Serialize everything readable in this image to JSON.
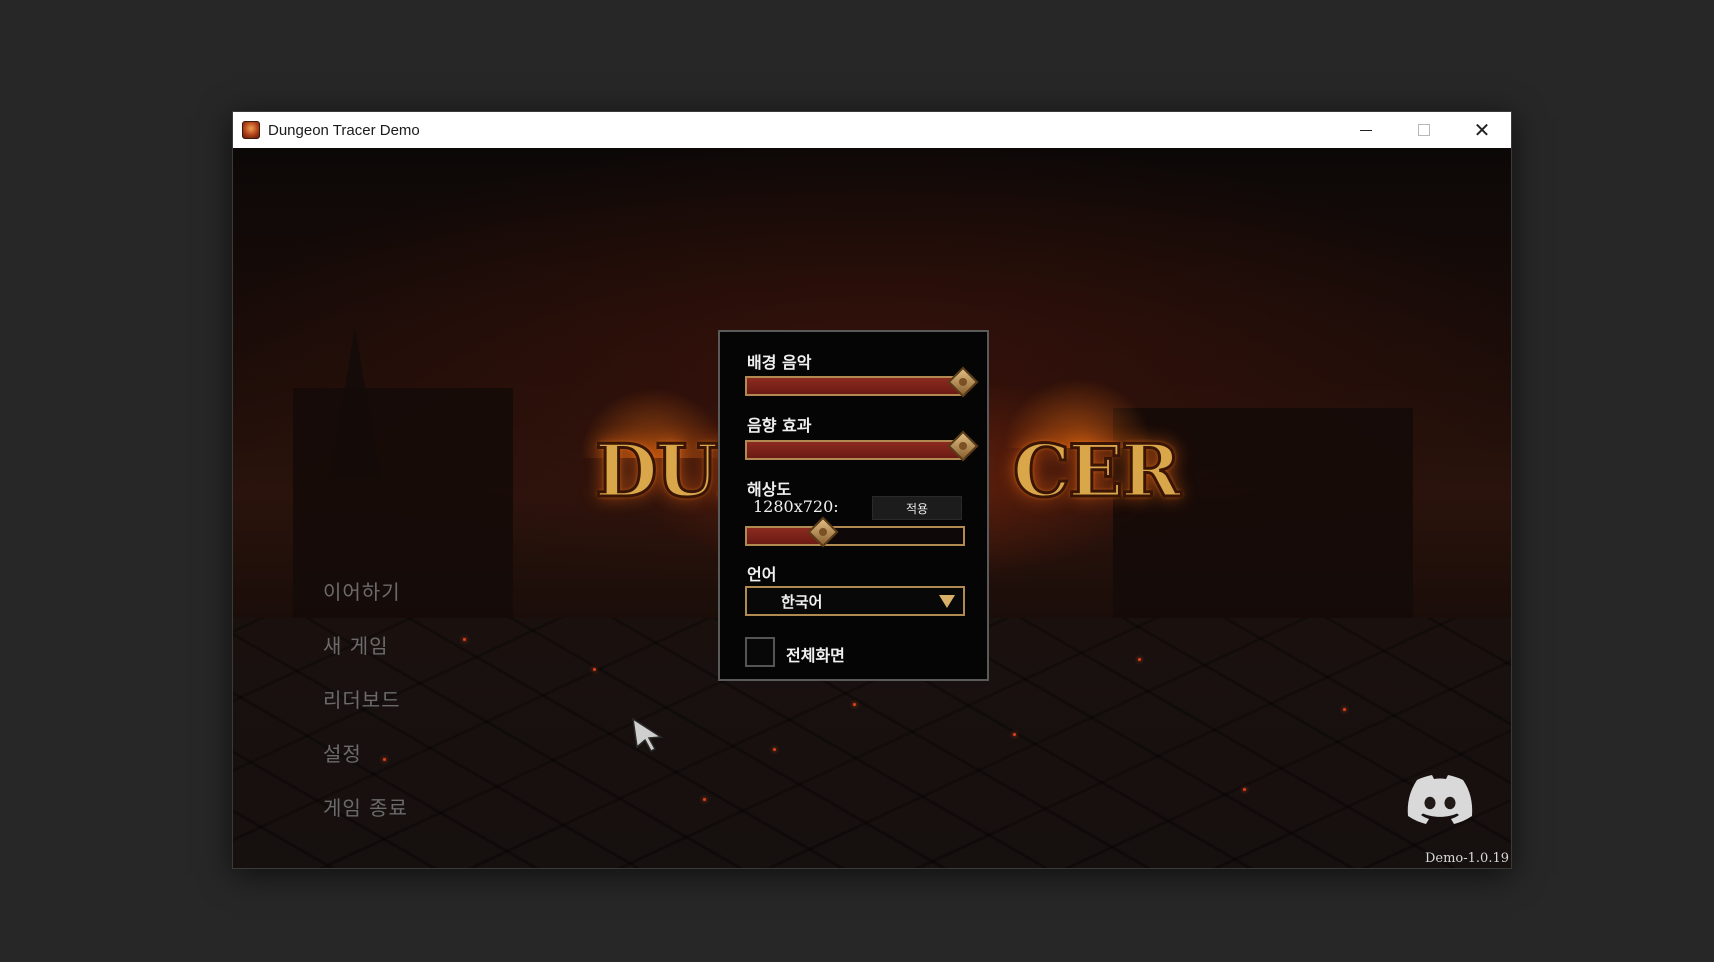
{
  "window": {
    "title": "Dungeon Tracer Demo"
  },
  "logo": {
    "visible_left": "DUN",
    "visible_right": "CER"
  },
  "main_menu": {
    "items": [
      "이어하기",
      "새 게임",
      "리더보드",
      "설정",
      "게임 종료"
    ]
  },
  "settings": {
    "bgm_label": "배경 음악",
    "bgm_level": 1.0,
    "sfx_label": "음향 효과",
    "sfx_level": 1.0,
    "resolution_label": "해상도",
    "resolution_value": "1280x720:",
    "apply_label": "적용",
    "resolution_slider_level": 0.35,
    "language_label": "언어",
    "language_value": "한국어",
    "fullscreen_label": "전체화면",
    "fullscreen_checked": false
  },
  "version": "Demo-1.0.19",
  "colors": {
    "slider_fill": "#8c2a20",
    "accent_gold": "#b08a50",
    "menu_text": "#6b6b6b"
  },
  "icons": {
    "app": "dungeon-tracer-app-icon",
    "discord": "discord-icon",
    "cursor": "arrow-cursor-icon"
  }
}
